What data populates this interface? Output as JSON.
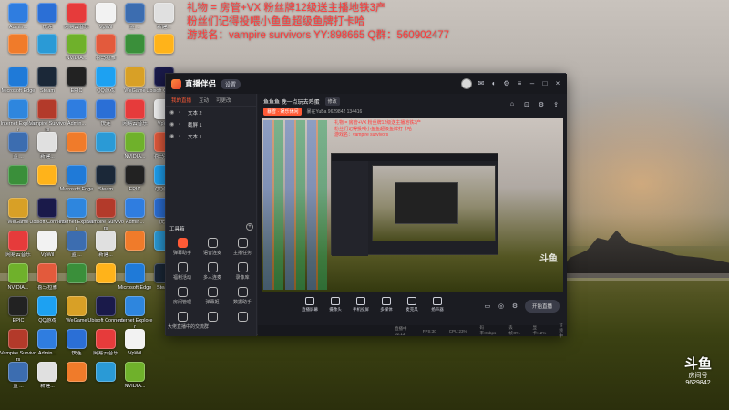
{
  "overlay_text": {
    "line1": "礼物 = 房管+VX 粉丝牌12级送主播地铁3产",
    "line2": "粉丝们记得投喂小鱼鱼超级鱼牌打卡哈",
    "line3": "游戏名：vampire survivors YY:898665 Q群：560902477"
  },
  "desktop_icons": [
    {
      "label": "Admin...",
      "color": "#2f7de0"
    },
    {
      "label": "快连",
      "color": "#2b6fd6"
    },
    {
      "label": "网易云音乐",
      "color": "#e63b3b"
    },
    {
      "label": "VpWil",
      "color": "#f2f2f2"
    },
    {
      "label": "蓝 ...",
      "color": "#3c6db0"
    },
    {
      "label": "新建...",
      "color": "#e0e0e0"
    },
    {
      "label": "",
      "color": "#f07b2a"
    },
    {
      "label": "",
      "color": "#2a9ad6"
    },
    {
      "label": "NVIDIA...",
      "color": "#6fb12b"
    },
    {
      "label": "喜马拉雅",
      "color": "#e35a3c"
    },
    {
      "label": "",
      "color": "#3a8f3a"
    },
    {
      "label": "",
      "color": "#ffb31a"
    },
    {
      "label": "Microsoft Edge",
      "color": "#1f7ad8"
    },
    {
      "label": "Steam",
      "color": "#1b2838"
    },
    {
      "label": "EPIC",
      "color": "#222222"
    },
    {
      "label": "QQ游戏",
      "color": "#1da1f2"
    },
    {
      "label": "WeGame",
      "color": "#d8a026"
    },
    {
      "label": "Ubisoft Connect",
      "color": "#1a1a4a"
    },
    {
      "label": "Internet Explorer",
      "color": "#2e86de"
    },
    {
      "label": "Vampire Survivors",
      "color": "#b33a2a"
    }
  ],
  "app": {
    "name": "直播伴侣",
    "version": "设置",
    "left_tabs": [
      "我的直播",
      "互动",
      "可更改"
    ],
    "sources": [
      "文本 2",
      "截屏 1",
      "文本 1"
    ],
    "toolbox_label": "工具箱",
    "toolbox_add": "+",
    "tools": [
      "弹幕助手",
      "语音连麦",
      "主播任务",
      "福利活动",
      "多人连麦",
      "录像库",
      "房间管理",
      "弹幕姬",
      "数据助手",
      "大佬直播中的交流群",
      "",
      ""
    ],
    "room": {
      "title": "鱼鱼鱼 晚一点玩去鸡蛋",
      "edit": "修改",
      "category": "暴雪 · 娱乐休闲",
      "meta": "暴在YuBa  9629842  134416"
    },
    "preview_text": "礼物 = 房管+VX 粉丝牌12级送主播地铁3产\n粉丝们记得投喂小鱼鱼超级鱼牌打卡哈\n游戏名：vampire survivors",
    "preview_watermark": "斗鱼",
    "controls": [
      "直播屏幕",
      "摄像头",
      "手机投屏",
      "多媒体",
      "麦克风",
      "扬声器"
    ],
    "start_button": "开始直播",
    "status": [
      "直播中 02:13",
      "FPS:30",
      "CPU:23%",
      "码率:0kbps",
      "丢帧:0%",
      "显卡:12%",
      "音频中"
    ]
  },
  "watermark": {
    "logo": "斗鱼",
    "room_label": "房间号",
    "room_id": "9629842"
  }
}
